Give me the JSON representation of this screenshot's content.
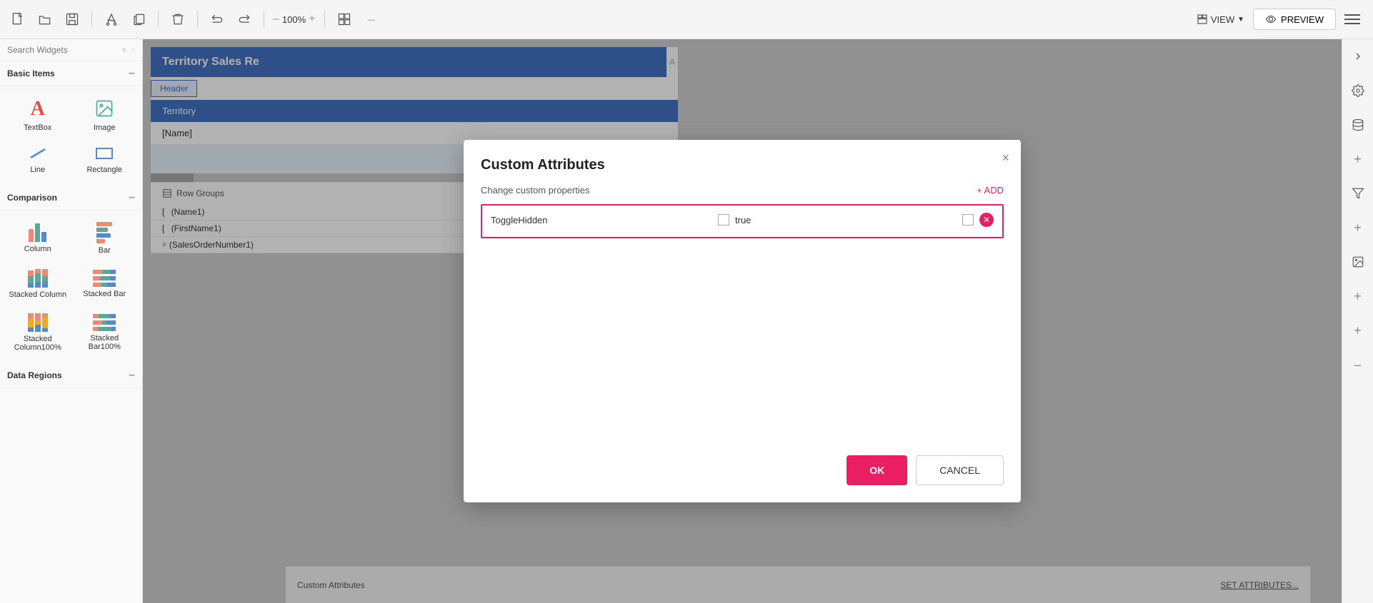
{
  "toolbar": {
    "zoom_level": "100%",
    "view_label": "VIEW",
    "preview_label": "PREVIEW"
  },
  "left_sidebar": {
    "search_placeholder": "Search Widgets",
    "sections": [
      {
        "label": "Basic Items",
        "items": [
          {
            "id": "textbox",
            "label": "TextBox",
            "icon": "A"
          },
          {
            "id": "image",
            "label": "Image",
            "icon": "img"
          },
          {
            "id": "line",
            "label": "Line",
            "icon": "line"
          },
          {
            "id": "rectangle",
            "label": "Rectangle",
            "icon": "rect"
          }
        ]
      },
      {
        "label": "Comparison",
        "items": [
          {
            "id": "column",
            "label": "Column",
            "icon": "column"
          },
          {
            "id": "bar",
            "label": "Bar",
            "icon": "bar"
          },
          {
            "id": "stacked-column",
            "label": "Stacked Column",
            "icon": "stacked-column"
          },
          {
            "id": "stacked-bar",
            "label": "Stacked Bar",
            "icon": "stacked-bar"
          },
          {
            "id": "stacked-column100",
            "label": "Stacked Column100%",
            "icon": "stacked-column100"
          },
          {
            "id": "stacked-bar100",
            "label": "Stacked Bar100%",
            "icon": "stacked-bar100"
          }
        ]
      },
      {
        "label": "Data Regions",
        "items": []
      }
    ]
  },
  "report": {
    "title": "Territory Sales Re",
    "tab_label": "Header",
    "table_header": "Territory",
    "name_cell": "[Name]",
    "row_groups_label": "Row Groups",
    "row_items": [
      "(Name1)",
      "(FirstName1)",
      "(SalesOrderNumber1)"
    ]
  },
  "modal": {
    "title": "Custom Attributes",
    "subtitle": "Change custom properties",
    "add_label": "+ ADD",
    "close_icon": "×",
    "attribute": {
      "name": "ToggleHidden",
      "value": "true"
    },
    "ok_label": "OK",
    "cancel_label": "CANCEL"
  },
  "bottom_panel": {
    "label": "Custom Attributes",
    "set_btn": "SET ATTRIBUTES..."
  }
}
